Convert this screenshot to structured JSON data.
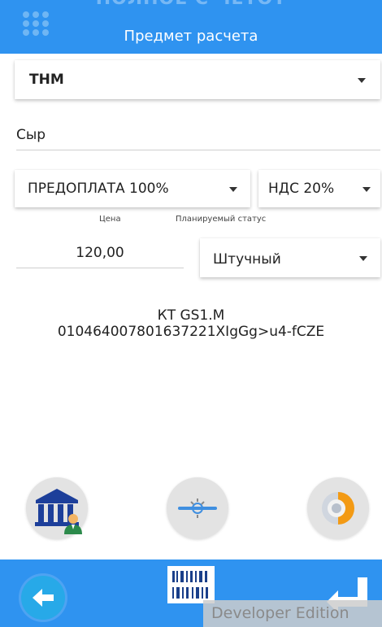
{
  "header": {
    "ghost_title": "ПОЛНОЕ С ЧЕТОТ",
    "title": "Предмет расчета"
  },
  "form": {
    "item_type": "ТНМ",
    "item_name": "Сыр",
    "payment_method": "ПРЕДОПЛАТА 100%",
    "vat_rate": "НДС 20%",
    "price_label": "Цена",
    "planned_status_label": "Планируемый статус",
    "price": "120,00",
    "unit": "Штучный",
    "code_line1": "КТ GS1.M",
    "code_line2": "010464007801637221XIgGg>u4-fCZE"
  },
  "actions": {
    "bank_icon": "bank-with-person-icon",
    "scan_icon": "scanner-icon",
    "dial_icon": "dial-toggle-icon"
  },
  "bottom_bar": {
    "back_icon": "arrow-left-icon",
    "barcode_icon": "barcode-icon",
    "enter_icon": "enter-return-icon",
    "watermark": "Developer Edition"
  },
  "colors": {
    "primary": "#2f93f0",
    "accent_orange": "#f39a14",
    "bank_blue": "#1d3f9a"
  }
}
